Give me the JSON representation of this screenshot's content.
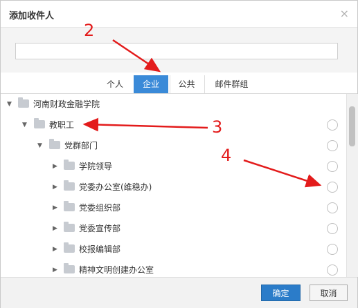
{
  "dialog": {
    "title": "添加收件人",
    "close_icon": "×"
  },
  "search": {
    "value": "",
    "placeholder": ""
  },
  "tabs": [
    {
      "label": "个人",
      "active": false
    },
    {
      "label": "企业",
      "active": true
    },
    {
      "label": "公共",
      "active": false
    },
    {
      "label": "邮件群组",
      "active": false
    }
  ],
  "tree": {
    "items": [
      {
        "label": "河南财政金融学院",
        "level": 0,
        "expanded": true
      },
      {
        "label": "教职工",
        "level": 1,
        "expanded": true
      },
      {
        "label": "党群部门",
        "level": 2,
        "expanded": true
      },
      {
        "label": "学院领导",
        "level": 3,
        "expanded": false
      },
      {
        "label": "党委办公室(维稳办)",
        "level": 3,
        "expanded": false
      },
      {
        "label": "党委组织部",
        "level": 3,
        "expanded": false
      },
      {
        "label": "党委宣传部",
        "level": 3,
        "expanded": false
      },
      {
        "label": "校报编辑部",
        "level": 3,
        "expanded": false
      },
      {
        "label": "精神文明创建办公室",
        "level": 3,
        "expanded": false
      }
    ]
  },
  "footer": {
    "confirm_label": "确定",
    "cancel_label": "取消"
  },
  "annotations": {
    "a2": "2",
    "a3": "3",
    "a4": "4",
    "color": "#e31b1b"
  }
}
